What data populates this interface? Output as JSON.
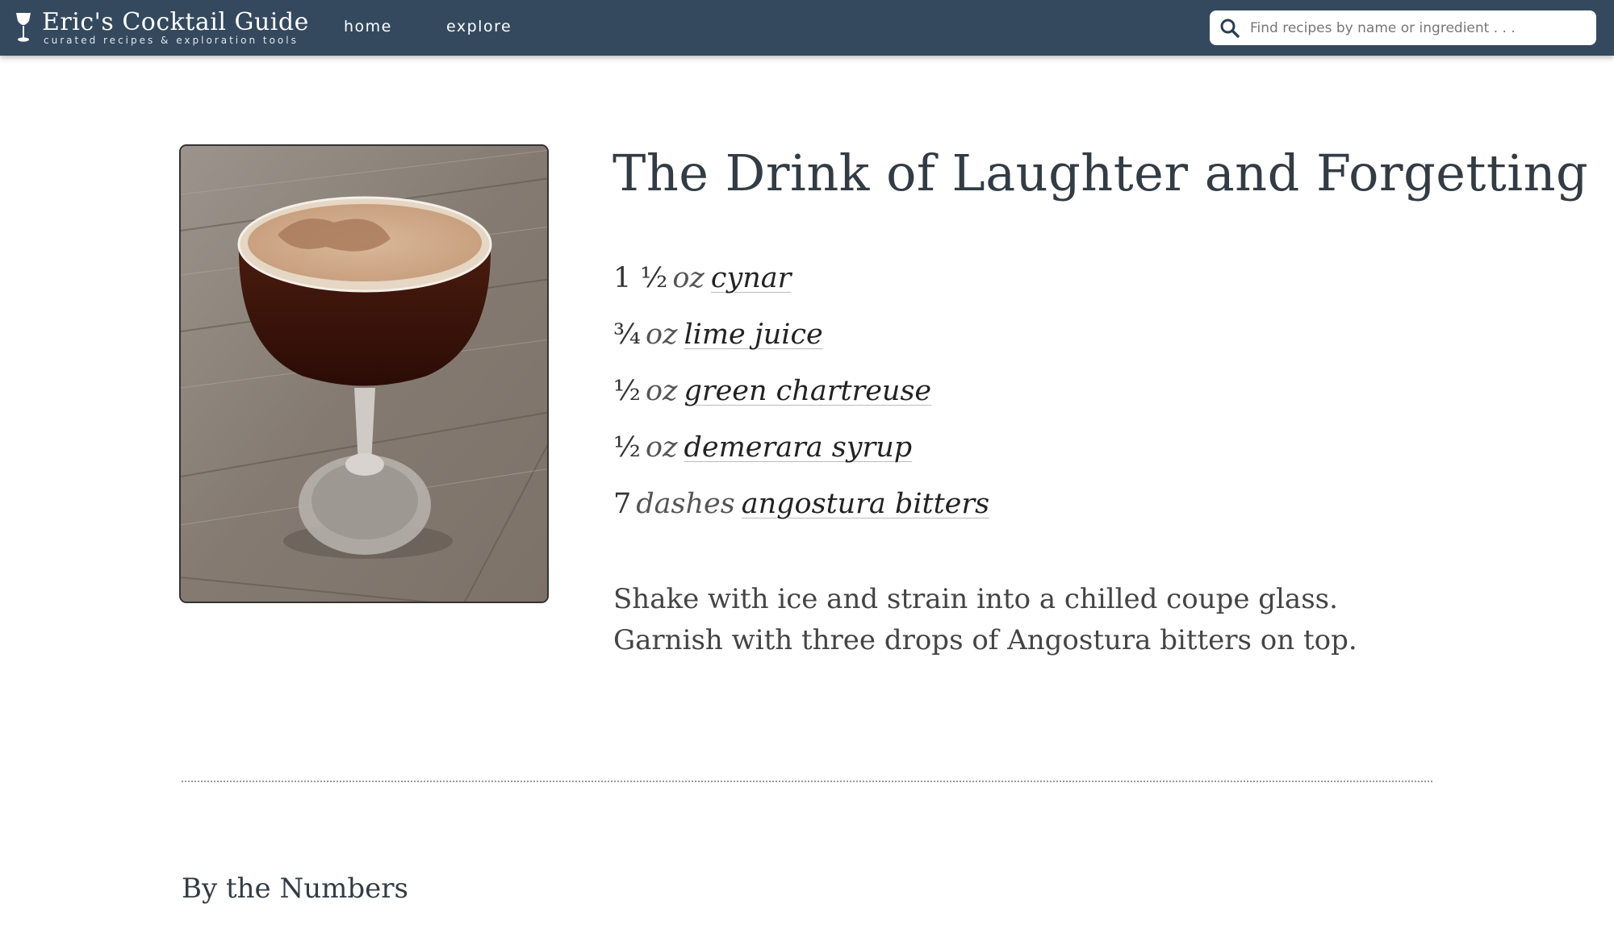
{
  "header": {
    "brand_title": "Eric's Cocktail Guide",
    "brand_tagline": "curated recipes & exploration tools",
    "brand_icon": "cocktail-glass-icon",
    "nav": [
      {
        "label": "home"
      },
      {
        "label": "explore"
      }
    ],
    "search": {
      "placeholder": "Find recipes by name or ingredient . . .",
      "value": "",
      "icon": "search-icon"
    }
  },
  "recipe": {
    "title": "The Drink of Laughter and Forgetting",
    "photo_icon": "cocktail-photo",
    "ingredients": [
      {
        "amount": "1 ½",
        "unit": "oz",
        "name": "cynar"
      },
      {
        "amount": "¾",
        "unit": "oz",
        "name": "lime juice"
      },
      {
        "amount": "½",
        "unit": "oz",
        "name": "green chartreuse"
      },
      {
        "amount": "½",
        "unit": "oz",
        "name": "demerara syrup"
      },
      {
        "amount": "7",
        "unit": "dashes",
        "name": "angostura bitters"
      }
    ],
    "instructions": "Shake with ice and strain into a chilled coupe glass. Garnish with three drops of Angostura bitters on top."
  },
  "sections": {
    "by_the_numbers": "By the Numbers"
  },
  "colors": {
    "header_bg": "#34495e",
    "page_bg": "#ffffff",
    "text": "#333333"
  }
}
